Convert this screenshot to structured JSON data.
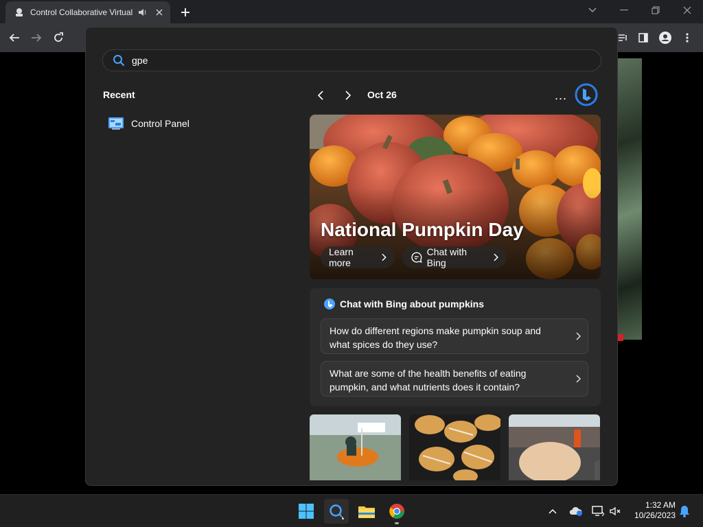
{
  "browser": {
    "tab_title": "Control Collaborative Virtual",
    "new_tab_label": "+"
  },
  "search": {
    "query": "gpe"
  },
  "recent": {
    "label": "Recent",
    "items": [
      {
        "label": "Control Panel",
        "icon": "control-panel-icon"
      }
    ]
  },
  "highlights": {
    "date": "Oct 26",
    "more_label": "...",
    "hero": {
      "title": "National Pumpkin Day",
      "learn_more": "Learn more",
      "chat_with_bing": "Chat with Bing"
    },
    "chat_card": {
      "header": "Chat with Bing about pumpkins",
      "questions": [
        "How do different regions make pumpkin soup and what spices do they use?",
        "What are some of the health benefits of eating pumpkin, and what nutrients does it contain?"
      ]
    }
  },
  "taskbar": {
    "time": "1:32 AM",
    "date": "10/26/2023"
  },
  "colors": {
    "flyout_bg": "#232323",
    "card_bg": "#2c2c2c",
    "accent_blue": "#4aa3ff",
    "taskbar_bg": "#202020"
  }
}
